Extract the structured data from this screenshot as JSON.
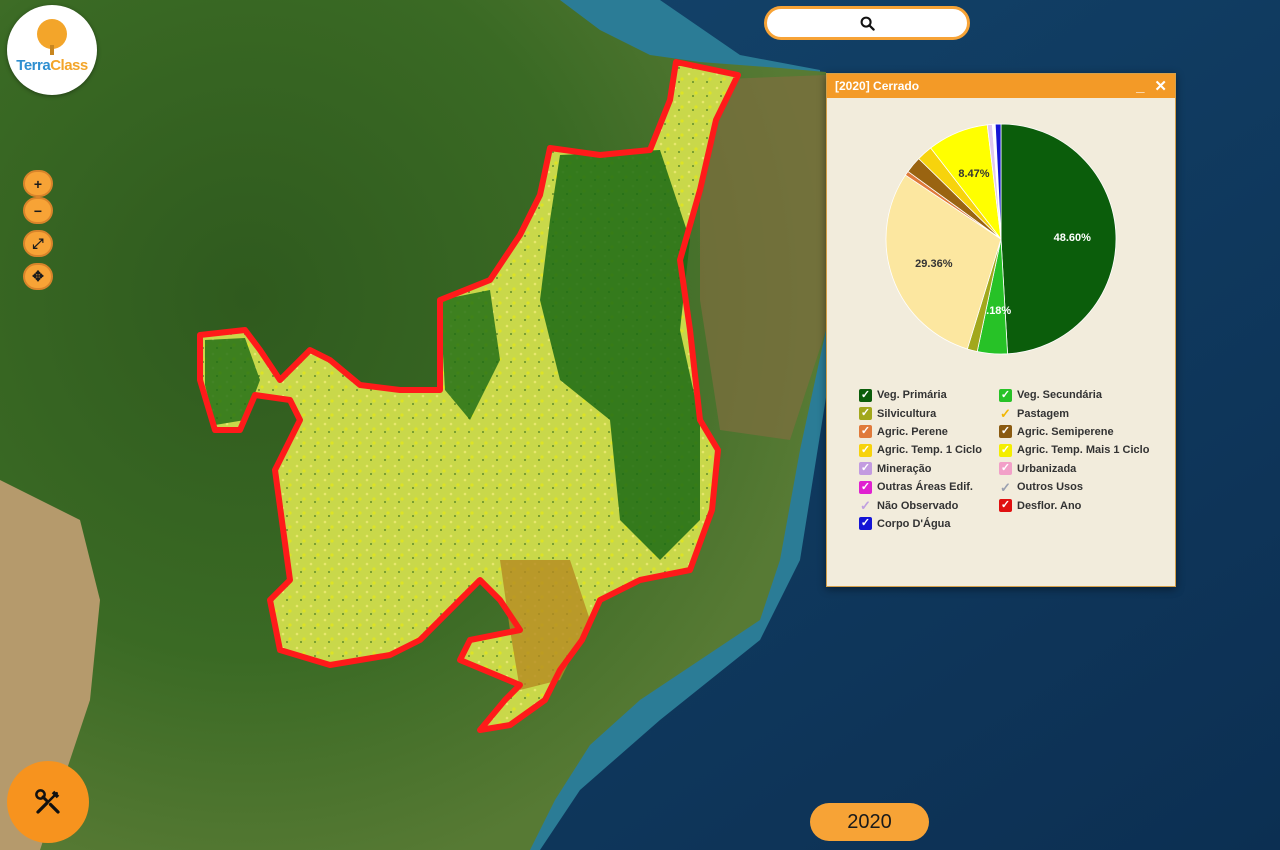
{
  "app": {
    "logo_text_1": "Terra",
    "logo_text_2": "Class"
  },
  "search": {
    "icon": "search-icon",
    "placeholder": ""
  },
  "map_controls": [
    {
      "id": "zoom-in",
      "label": "+",
      "icon": "plus-icon"
    },
    {
      "id": "zoom-out",
      "label": "−",
      "icon": "minus-icon"
    },
    {
      "id": "fullscreen",
      "label": "⤢",
      "icon": "expand-icon"
    },
    {
      "id": "pan",
      "label": "✥",
      "icon": "move-icon"
    }
  ],
  "stats_panel": {
    "title": "[2020] Cerrado",
    "minimize": "_",
    "close": "✕",
    "pie": {
      "slices": [
        {
          "label": "Veg. Primária",
          "percent": 48.6,
          "color": "#0b5d0b",
          "show_label": "48.60%"
        },
        {
          "label": "Veg. Secundária",
          "percent": 4.18,
          "color": "#27c227",
          "show_label": "4.18%"
        },
        {
          "label": "Silvicultura",
          "percent": 1.4,
          "color": "#a2a81c",
          "show_label": ""
        },
        {
          "label": "Pastagem",
          "percent": 29.36,
          "color": "#fce7a0",
          "show_label": "29.36%"
        },
        {
          "label": "Agric. Perene",
          "percent": 0.6,
          "color": "#e07a3a",
          "show_label": ""
        },
        {
          "label": "Agric. Semiperene",
          "percent": 2.3,
          "color": "#9a6411",
          "show_label": ""
        },
        {
          "label": "Agric. Temp. 1 Ciclo",
          "percent": 2.2,
          "color": "#f7d30c",
          "show_label": ""
        },
        {
          "label": "Agric. Temp. Mais 1 Ciclo",
          "percent": 8.47,
          "color": "#ffff00",
          "show_label": "8.47%"
        },
        {
          "label": "Outros",
          "percent": 0.7,
          "color": "#e0c8f0",
          "show_label": ""
        },
        {
          "label": "Não Observado",
          "percent": 0.4,
          "color": "#ffffff",
          "show_label": ""
        },
        {
          "label": "Corpo D'Água",
          "percent": 0.79,
          "color": "#1414d6",
          "show_label": ""
        }
      ]
    },
    "legend": [
      {
        "label": "Veg. Primária",
        "color": "#0b5d0b",
        "open": false
      },
      {
        "label": "Veg. Secundária",
        "color": "#27c227",
        "open": false
      },
      {
        "label": "Silvicultura",
        "color": "#a2a81c",
        "open": false
      },
      {
        "label": "Pastagem",
        "color": "#f2b705",
        "open": true
      },
      {
        "label": "Agric. Perene",
        "color": "#e07a3a",
        "open": false
      },
      {
        "label": "Agric. Semiperene",
        "color": "#8a5a10",
        "open": false
      },
      {
        "label": "Agric. Temp. 1 Ciclo",
        "color": "#f7d30c",
        "open": false
      },
      {
        "label": "Agric. Temp. Mais 1 Ciclo",
        "color": "#f4ee00",
        "open": false
      },
      {
        "label": "Mineração",
        "color": "#c39be0",
        "open": false
      },
      {
        "label": "Urbanizada",
        "color": "#f2a0c8",
        "open": false
      },
      {
        "label": "Outras Áreas Edif.",
        "color": "#e020d0",
        "open": false
      },
      {
        "label": "Outros Usos",
        "color": "#9aa0b0",
        "open": true
      },
      {
        "label": "Não Observado",
        "color": "#c0a0e0",
        "open": true
      },
      {
        "label": "Desflor. Ano",
        "color": "#e01010",
        "open": false
      },
      {
        "label": "Corpo D'Água",
        "color": "#1414d6",
        "open": false
      }
    ]
  },
  "bottom": {
    "tools_icon": "tools-icon",
    "year": "2020"
  },
  "colors": {
    "accent": "#f7a336",
    "outline": "#ff1a1a",
    "ocean": "#0f3a63",
    "land": "#3c6a26"
  }
}
